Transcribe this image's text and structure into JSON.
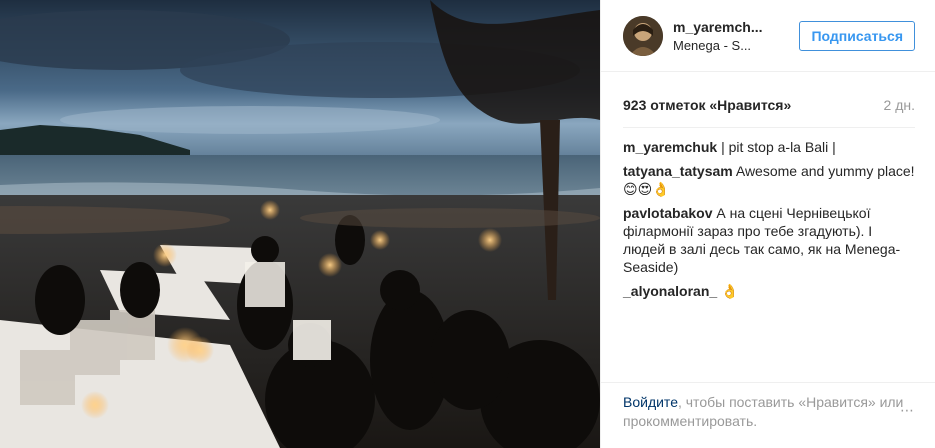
{
  "post": {
    "image_alt": "Beach dinner at sunset in Bali",
    "header": {
      "username": "m_yaremch...",
      "location": "Menega - S...",
      "follow_label": "Подписаться"
    },
    "likes_label": "923 отметок «Нравится»",
    "time_label": "2 дн.",
    "comments": [
      {
        "user": "m_yaremchuk",
        "text": "| pit stop a-la Bali |"
      },
      {
        "user": "tatyana_tatysam",
        "text": "Awesome and yummy place! 😊😍👌"
      },
      {
        "user": "pavlotabakov",
        "text": "А на сцені Чернівецької філармонії зараз про тебе згадують). І людей в залі десь так само, як на Menega-Seaside)"
      },
      {
        "user": "_alyonaloran_",
        "text": "👌"
      }
    ],
    "footer": {
      "login_link": "Войдите",
      "rest_text": ", чтобы поставить «Нравится» или прокомментировать.",
      "more_icon": "⋯"
    }
  }
}
